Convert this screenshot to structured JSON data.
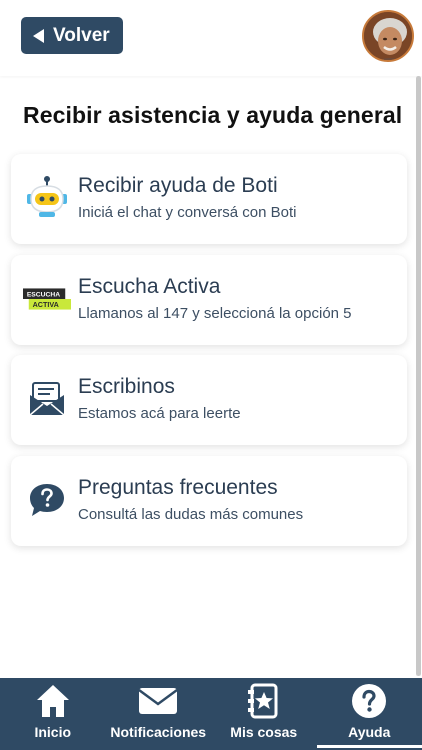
{
  "header": {
    "back_label": "Volver"
  },
  "page": {
    "title": "Recibir asistencia y ayuda general"
  },
  "cards": [
    {
      "title": "Recibir ayuda de Boti",
      "subtitle": "Iniciá el chat y conversá con Boti",
      "icon": "boti-robot-icon"
    },
    {
      "title": "Escucha Activa",
      "subtitle": "Llamanos al 147 y seleccioná la opción 5",
      "icon": "escucha-activa-logo",
      "logo_text": [
        "ESCUCHA",
        "ACTIVA"
      ]
    },
    {
      "title": "Escribinos",
      "subtitle": "Estamos acá para leerte",
      "icon": "envelope-icon"
    },
    {
      "title": "Preguntas frecuentes",
      "subtitle": "Consultá las dudas más comunes",
      "icon": "question-chat-icon"
    }
  ],
  "nav": {
    "items": [
      {
        "label": "Inicio",
        "icon": "home-icon",
        "active": false
      },
      {
        "label": "Notificaciones",
        "icon": "mail-icon",
        "active": false
      },
      {
        "label": "Mis cosas",
        "icon": "star-card-icon",
        "active": false
      },
      {
        "label": "Ayuda",
        "icon": "help-circle-icon",
        "active": true
      }
    ]
  },
  "colors": {
    "primary": "#2f4a64",
    "boti_yellow": "#f5c518",
    "boti_blue": "#4fb7e6",
    "escucha_green": "#c9e83a"
  }
}
